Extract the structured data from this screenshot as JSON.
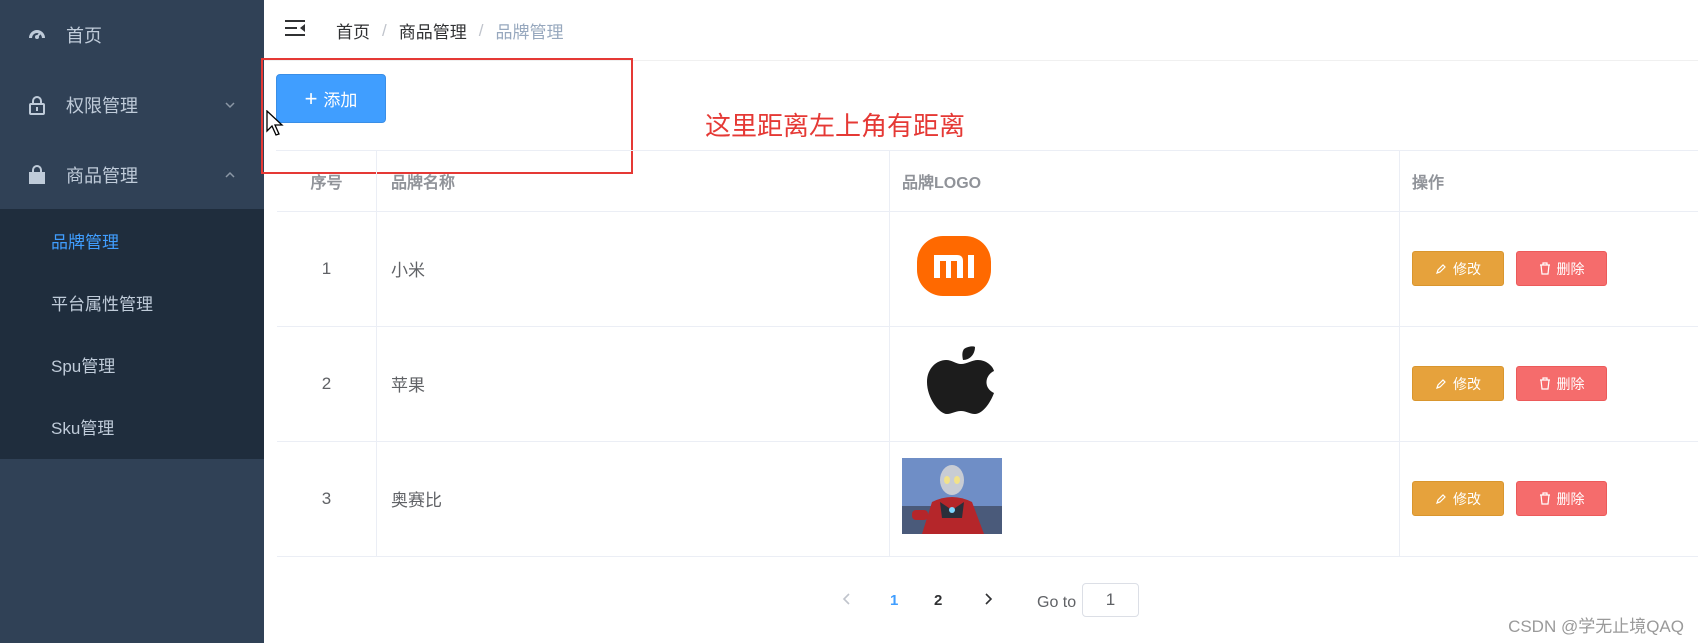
{
  "sidebar": {
    "items": [
      {
        "label": "首页",
        "icon": "dashboard-icon"
      },
      {
        "label": "权限管理",
        "icon": "lock-icon"
      },
      {
        "label": "商品管理",
        "icon": "shopping-bag-icon"
      }
    ],
    "submenu": [
      {
        "label": "品牌管理",
        "active": true
      },
      {
        "label": "平台属性管理"
      },
      {
        "label": "Spu管理"
      },
      {
        "label": "Sku管理"
      }
    ]
  },
  "breadcrumb": [
    "首页",
    "商品管理",
    "品牌管理"
  ],
  "toolbar": {
    "add_label": "添加"
  },
  "annotation": "这里距离左上角有距离",
  "table": {
    "headers": [
      "序号",
      "品牌名称",
      "品牌LOGO",
      "操作"
    ],
    "rows": [
      {
        "index": "1",
        "name": "小米",
        "logo": "xiaomi-logo"
      },
      {
        "index": "2",
        "name": "苹果",
        "logo": "apple-logo"
      },
      {
        "index": "3",
        "name": "奥赛比",
        "logo": "ultraman-image"
      }
    ],
    "edit_label": "修改",
    "delete_label": "删除"
  },
  "pagination": {
    "pages": [
      "1",
      "2"
    ],
    "current": "1",
    "goto_label": "Go to",
    "goto_value": "1"
  },
  "watermark": "CSDN @学无止境QAQ",
  "colors": {
    "sidebar_bg": "#304156",
    "submenu_bg": "#1f2d3d",
    "primary": "#409eff",
    "warning": "#e6a23c",
    "danger": "#f56c6c",
    "annotation": "#e53935"
  }
}
